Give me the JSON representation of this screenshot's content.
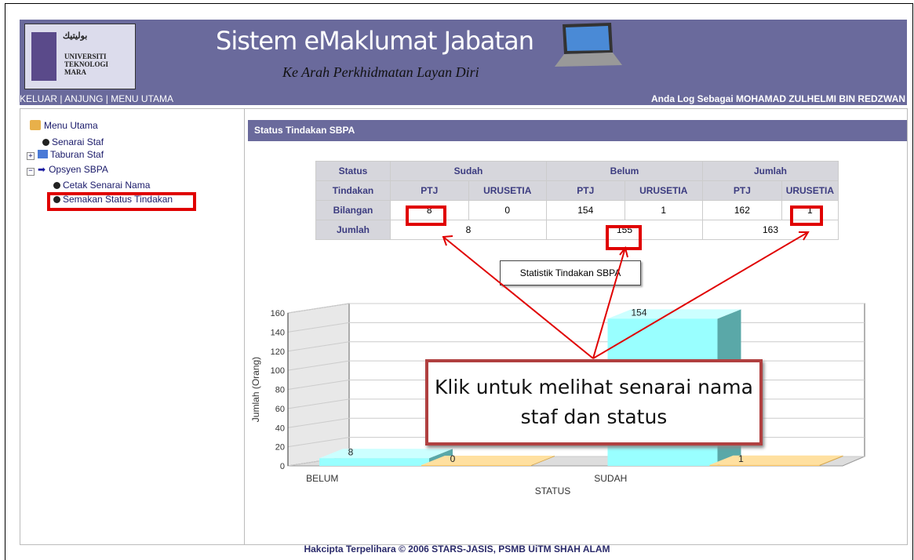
{
  "header": {
    "logo_text_top": "بوليتيك",
    "logo_text_uni": "UNIVERSITI",
    "logo_text_tek": "TEKNOLOGI",
    "logo_text_mara": "MARA",
    "title": "Sistem eMaklumat Jabatan",
    "subtitle": "Ke Arah Perkhidmatan Layan Diri"
  },
  "topbar": {
    "nav": "KELUAR | ANJUNG | MENU UTAMA",
    "login": "Anda Log Sebagai MOHAMAD ZULHELMI BIN REDZWAN"
  },
  "sidebar": {
    "root": "Menu Utama",
    "items": [
      {
        "label": "Senarai Staf"
      },
      {
        "label": "Taburan Staf"
      },
      {
        "label": "Opsyen SBPA"
      },
      {
        "label": "Cetak Senarai Nama"
      },
      {
        "label": "Semakan Status Tindakan"
      }
    ]
  },
  "content": {
    "title": "Status Tindakan SBPA",
    "table": {
      "h_status": "Status",
      "h_sudah": "Sudah",
      "h_belum": "Belum",
      "h_jumlah": "Jumlah",
      "h_tindakan": "Tindakan",
      "ptj": "PTJ",
      "urusetia": "URUSETIA",
      "bilangan_label": "Bilangan",
      "bilangan": [
        "8",
        "0",
        "154",
        "1",
        "162",
        "1"
      ],
      "jumlah_label": "Jumlah",
      "jumlah": [
        "8",
        "155",
        "163"
      ]
    },
    "chart_button": "Statistik Tindakan SBPA",
    "callout": "Klik untuk melihat senarai nama staf dan status"
  },
  "chart_data": {
    "type": "bar",
    "categories": [
      "BELUM",
      "SUDAH"
    ],
    "series": [
      {
        "values": [
          8,
          154
        ],
        "color": "#99ffff"
      },
      {
        "values": [
          0,
          1
        ],
        "color": "#ffc966"
      }
    ],
    "xlabel": "STATUS",
    "ylabel": "Jumlah (Orang)",
    "ylim": [
      0,
      160
    ],
    "yticks": [
      0,
      20,
      40,
      60,
      80,
      100,
      120,
      140,
      160
    ]
  },
  "footer": "Hakcipta Terpelihara © 2006 STARS-JASIS, PSMB UiTM SHAH ALAM"
}
